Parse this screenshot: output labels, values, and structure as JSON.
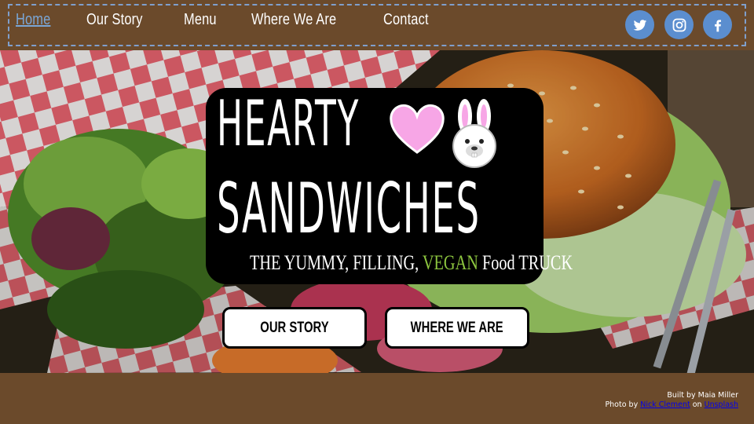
{
  "nav": {
    "links": [
      "Home",
      "Our Story",
      "Menu",
      "Where We Are",
      "Contact"
    ],
    "active": "Home"
  },
  "social": {
    "icons": [
      "twitter-icon",
      "instagram-icon",
      "facebook-icon"
    ],
    "color": "#5b8ecf"
  },
  "hero": {
    "brand_line1": "HEARTY",
    "brand_line2": "SANDWICHES",
    "tagline_pre": "THE YUMMY, FILLING, ",
    "tagline_vegan": "VEGAN",
    "tagline_post": " Food TRUCK",
    "heart_color": "#f7a6e6",
    "vegan_color": "#8dc63f",
    "buttons": [
      "OUR STORY",
      "WHERE WE ARE"
    ]
  },
  "footer": {
    "built_by": "Built by Maia Miller",
    "photo_by": "Photo by",
    "photographer": "Nick Clement",
    "on": "on",
    "source": "Unsplash"
  },
  "colors": {
    "brown": "#6b4a2b",
    "link_active": "#7aa6d6",
    "nav_border": "#7f9fcc"
  }
}
